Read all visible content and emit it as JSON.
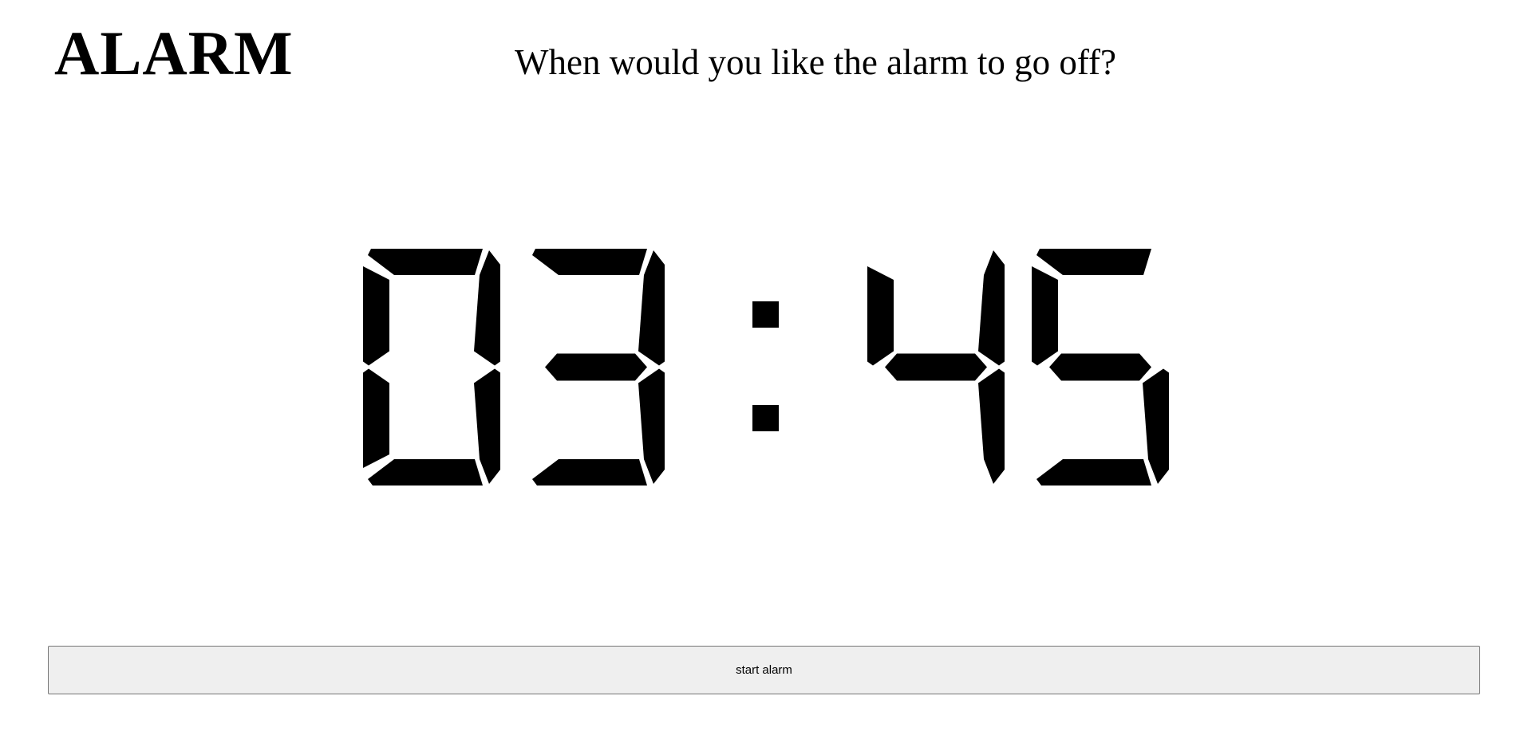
{
  "header": {
    "title": "ALARM",
    "prompt": "When would you like the alarm to go off?"
  },
  "clock": {
    "hours": "03",
    "minutes": "45",
    "separator": ":",
    "segment_color": "#000000"
  },
  "actions": {
    "start_label": "start alarm"
  }
}
